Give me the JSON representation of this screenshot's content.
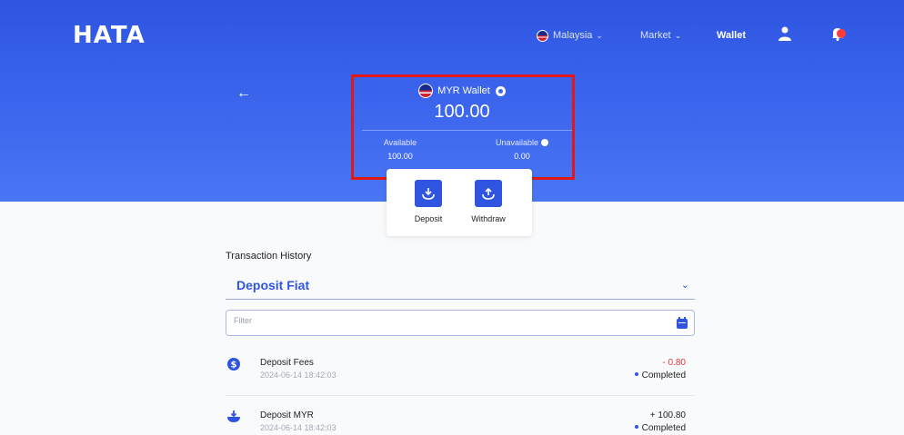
{
  "header": {
    "logo": "HATA",
    "country": "Malaysia",
    "market": "Market",
    "wallet": "Wallet"
  },
  "wallet_card": {
    "title": "MYR Wallet",
    "balance": "100.00",
    "available_label": "Available",
    "available_value": "100.00",
    "unavailable_label": "Unavailable",
    "unavailable_value": "0.00"
  },
  "actions": {
    "deposit": "Deposit",
    "withdraw": "Withdraw"
  },
  "history": {
    "title": "Transaction History",
    "selected_type": "Deposit Fiat",
    "filter_placeholder": "Filter",
    "transactions": [
      {
        "name": "Deposit Fees",
        "date": "2024-06-14 18:42:03",
        "amount": "- 0.80",
        "status": "Completed",
        "amount_color": "#e53935",
        "icon": "dollar-coin-icon"
      },
      {
        "name": "Deposit MYR",
        "date": "2024-06-14 18:42:03",
        "amount": "+ 100.80",
        "status": "Completed",
        "amount_color": "#222222",
        "icon": "deposit-tray-icon"
      }
    ]
  },
  "colors": {
    "brand": "#2f55e0",
    "highlight": "#e01818",
    "negative": "#e53935"
  }
}
